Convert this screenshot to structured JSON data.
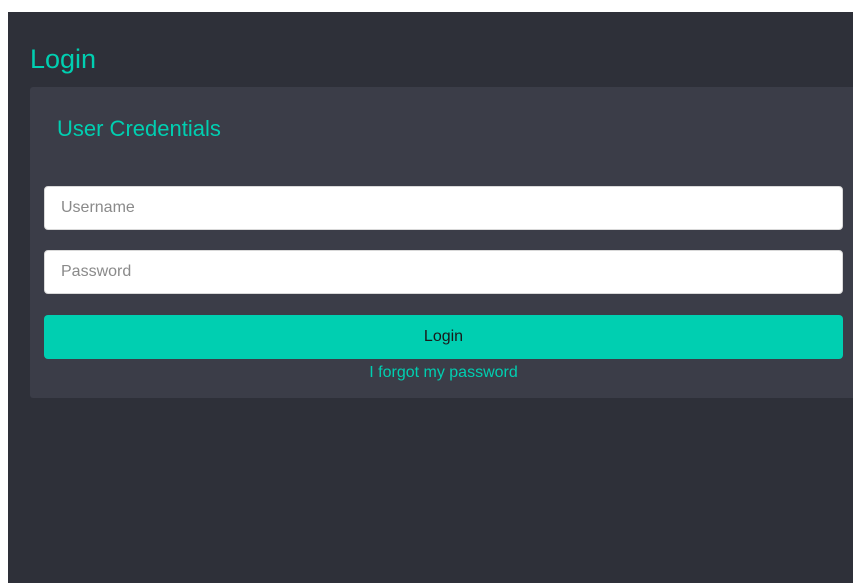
{
  "page": {
    "title": "Login"
  },
  "credentials_card": {
    "title": "User Credentials",
    "username_placeholder": "Username",
    "username_value": "",
    "password_placeholder": "Password",
    "password_value": "",
    "login_label": "Login",
    "forgot_label": "I forgot my password"
  },
  "colors": {
    "accent": "#00cfb1",
    "background": "#2e3039",
    "card": "#3b3d48"
  }
}
